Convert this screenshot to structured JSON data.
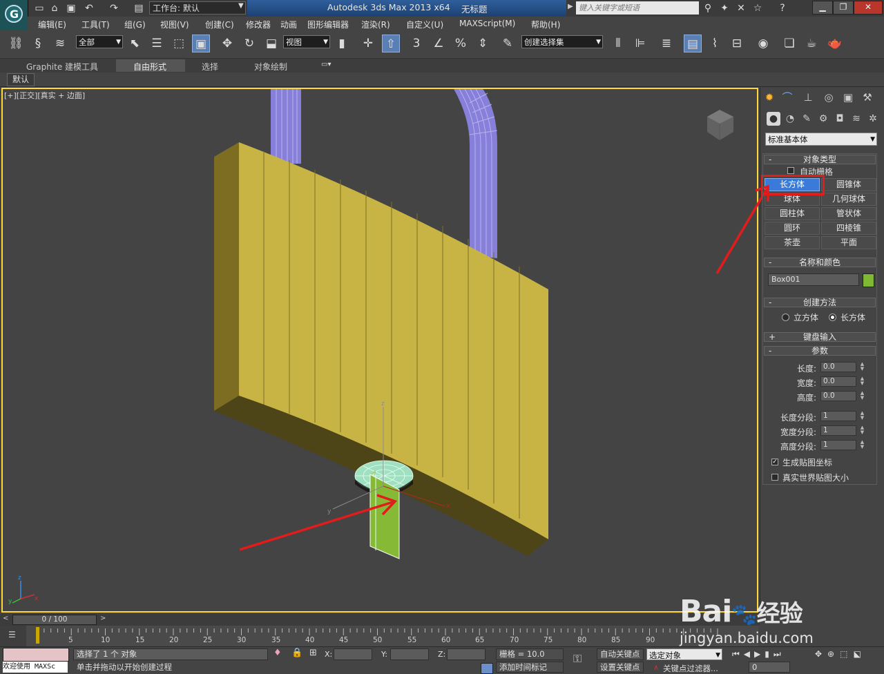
{
  "titlebar": {
    "workspace": "工作台: 默认",
    "app_title": "Autodesk 3ds Max  2013 x64",
    "doc_title": "无标题",
    "search_placeholder": "键入关键字或短语"
  },
  "menu": [
    "编辑(E)",
    "工具(T)",
    "组(G)",
    "视图(V)",
    "创建(C)",
    "修改器",
    "动画",
    "图形编辑器",
    "渲染(R)",
    "自定义(U)",
    "MAXScript(M)",
    "帮助(H)"
  ],
  "toolbar": {
    "filter": "全部",
    "ref_coord": "视图",
    "named_selection": "创建选择集",
    "snap_label": "3",
    "percent_label": "%"
  },
  "ribbon": {
    "tabs": [
      "Graphite 建模工具",
      "自由形式",
      "选择",
      "对象绘制"
    ],
    "active_tab": "自由形式",
    "subtab": "默认"
  },
  "viewport": {
    "label": "[+][正交][真实 + 边面]",
    "gizmo_axes": {
      "x": "x",
      "y": "y",
      "z": "z"
    }
  },
  "command_panel": {
    "category": "标准基本体",
    "object_type_title": "对象类型",
    "autogrid": "自动栅格",
    "buttons": [
      "长方体",
      "圆锥体",
      "球体",
      "几何球体",
      "圆柱体",
      "管状体",
      "圆环",
      "四棱锥",
      "茶壶",
      "平面"
    ],
    "active_button": "长方体",
    "name_color_title": "名称和颜色",
    "object_name": "Box001",
    "object_color": "#7fb832",
    "creation_method_title": "创建方法",
    "creation_methods": [
      "立方体",
      "长方体"
    ],
    "creation_method_selected": "长方体",
    "keyboard_entry_title": "键盘输入",
    "params_title": "参数",
    "params": [
      {
        "label": "长度:",
        "value": "0.0"
      },
      {
        "label": "宽度:",
        "value": "0.0"
      },
      {
        "label": "高度:",
        "value": "0.0"
      },
      {
        "label": "长度分段:",
        "value": "1"
      },
      {
        "label": "宽度分段:",
        "value": "1"
      },
      {
        "label": "高度分段:",
        "value": "1"
      }
    ],
    "gen_mapping": "生成贴图坐标",
    "gen_mapping_checked": true,
    "real_world": "真实世界贴图大小",
    "real_world_checked": false
  },
  "timeline": {
    "slider": "0 / 100",
    "ticks": [
      "5",
      "10",
      "15",
      "20",
      "25",
      "30",
      "35",
      "40",
      "45",
      "50",
      "55",
      "60",
      "65",
      "70",
      "75",
      "80",
      "85",
      "90"
    ]
  },
  "status": {
    "selected": "选择了 1 个 对象",
    "prompt": "单击并拖动以开始创建过程",
    "welcome": "欢迎使用 MAXSc",
    "x_label": "X:",
    "y_label": "Y:",
    "z_label": "Z:",
    "grid": "栅格 = 10.0",
    "auto_key": "自动关键点",
    "set_key": "设置关键点",
    "selected_object": "选定对象",
    "key_filters": "关键点过滤器...",
    "add_time_tag": "添加时间标记",
    "frame": "0"
  },
  "watermark": {
    "brand": "Bai",
    "brand_cn": "经验",
    "url": "jingyan.baidu.com"
  },
  "colors": {
    "lock_body": "#c8b444",
    "shackle": "#8d86e0",
    "box_green": "#86b936",
    "highlight_red": "#e31b1b",
    "selected_blue": "#3a7ad8"
  }
}
